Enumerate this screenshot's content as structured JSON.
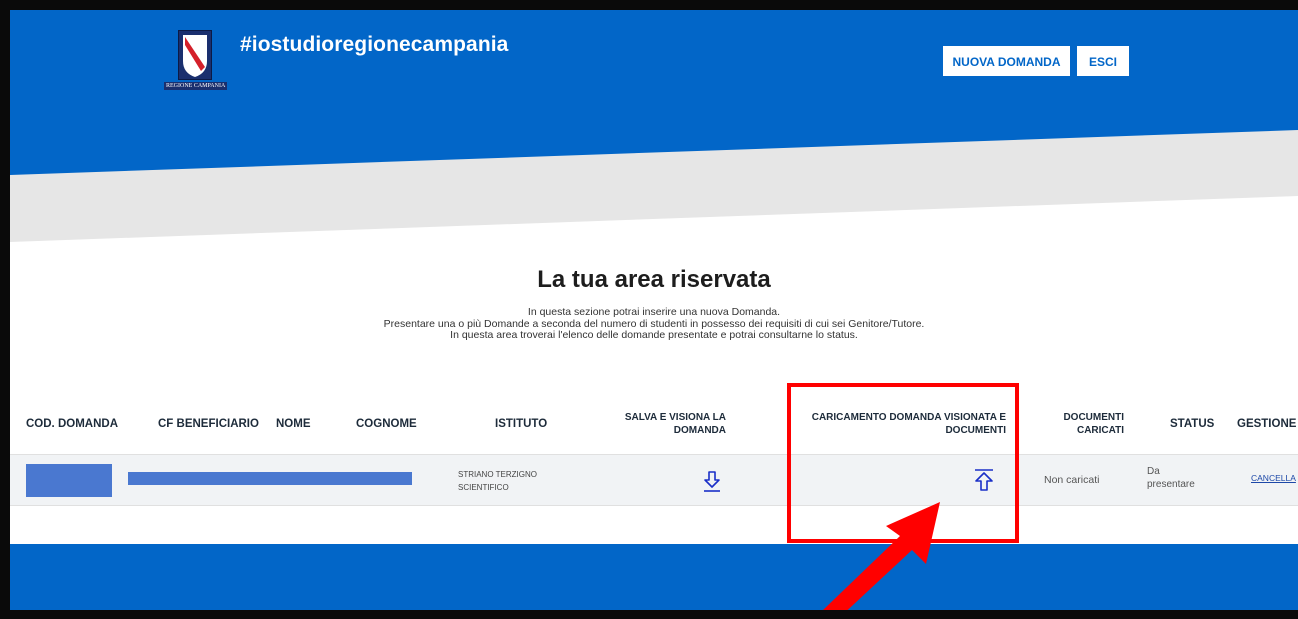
{
  "header": {
    "brand_title": "#iostudioregionecampania",
    "logo_caption": "REGIONE CAMPANIA",
    "buttons": {
      "new_application": "NUOVA DOMANDA",
      "exit": "ESCI"
    }
  },
  "main": {
    "title": "La tua area riservata",
    "intro_lines": [
      "In questa sezione potrai inserire una nuova Domanda.",
      "Presentare una o più Domande a seconda del numero di studenti in possesso dei requisiti di cui sei Genitore/Tutore.",
      "In questa area troverai l'elenco delle domande presentate e potrai consultarne lo status."
    ]
  },
  "table": {
    "headers": {
      "cod_domanda": "COD. DOMANDA",
      "cf_beneficiario": "CF BENEFICIARIO",
      "nome": "NOME",
      "cognome": "COGNOME",
      "istituto": "ISTITUTO",
      "salva_line1": "SALVA E VISIONA LA",
      "salva_line2": "DOMANDA",
      "caricamento_line1": "CARICAMENTO DOMANDA VISIONATA E",
      "caricamento_line2": "DOCUMENTI",
      "documenti_line1": "DOCUMENTI",
      "documenti_line2": "CARICATI",
      "status": "STATUS",
      "gestione": "GESTIONE"
    },
    "rows": [
      {
        "istituto_line1": "STRIANO TERZIGNO",
        "istituto_line2": "SCIENTIFICO",
        "download_icon": "download-arrow-icon",
        "upload_icon": "upload-arrow-icon",
        "documenti_caricati": "Non caricati",
        "status_line1": "Da",
        "status_line2": "presentare",
        "gestione_link": "CANCELLA"
      }
    ]
  },
  "annotation": {
    "color": "#ff0000"
  },
  "colors": {
    "primary": "#0266c8",
    "band": "#e6e6e6",
    "redaction": "#4a78d0"
  }
}
